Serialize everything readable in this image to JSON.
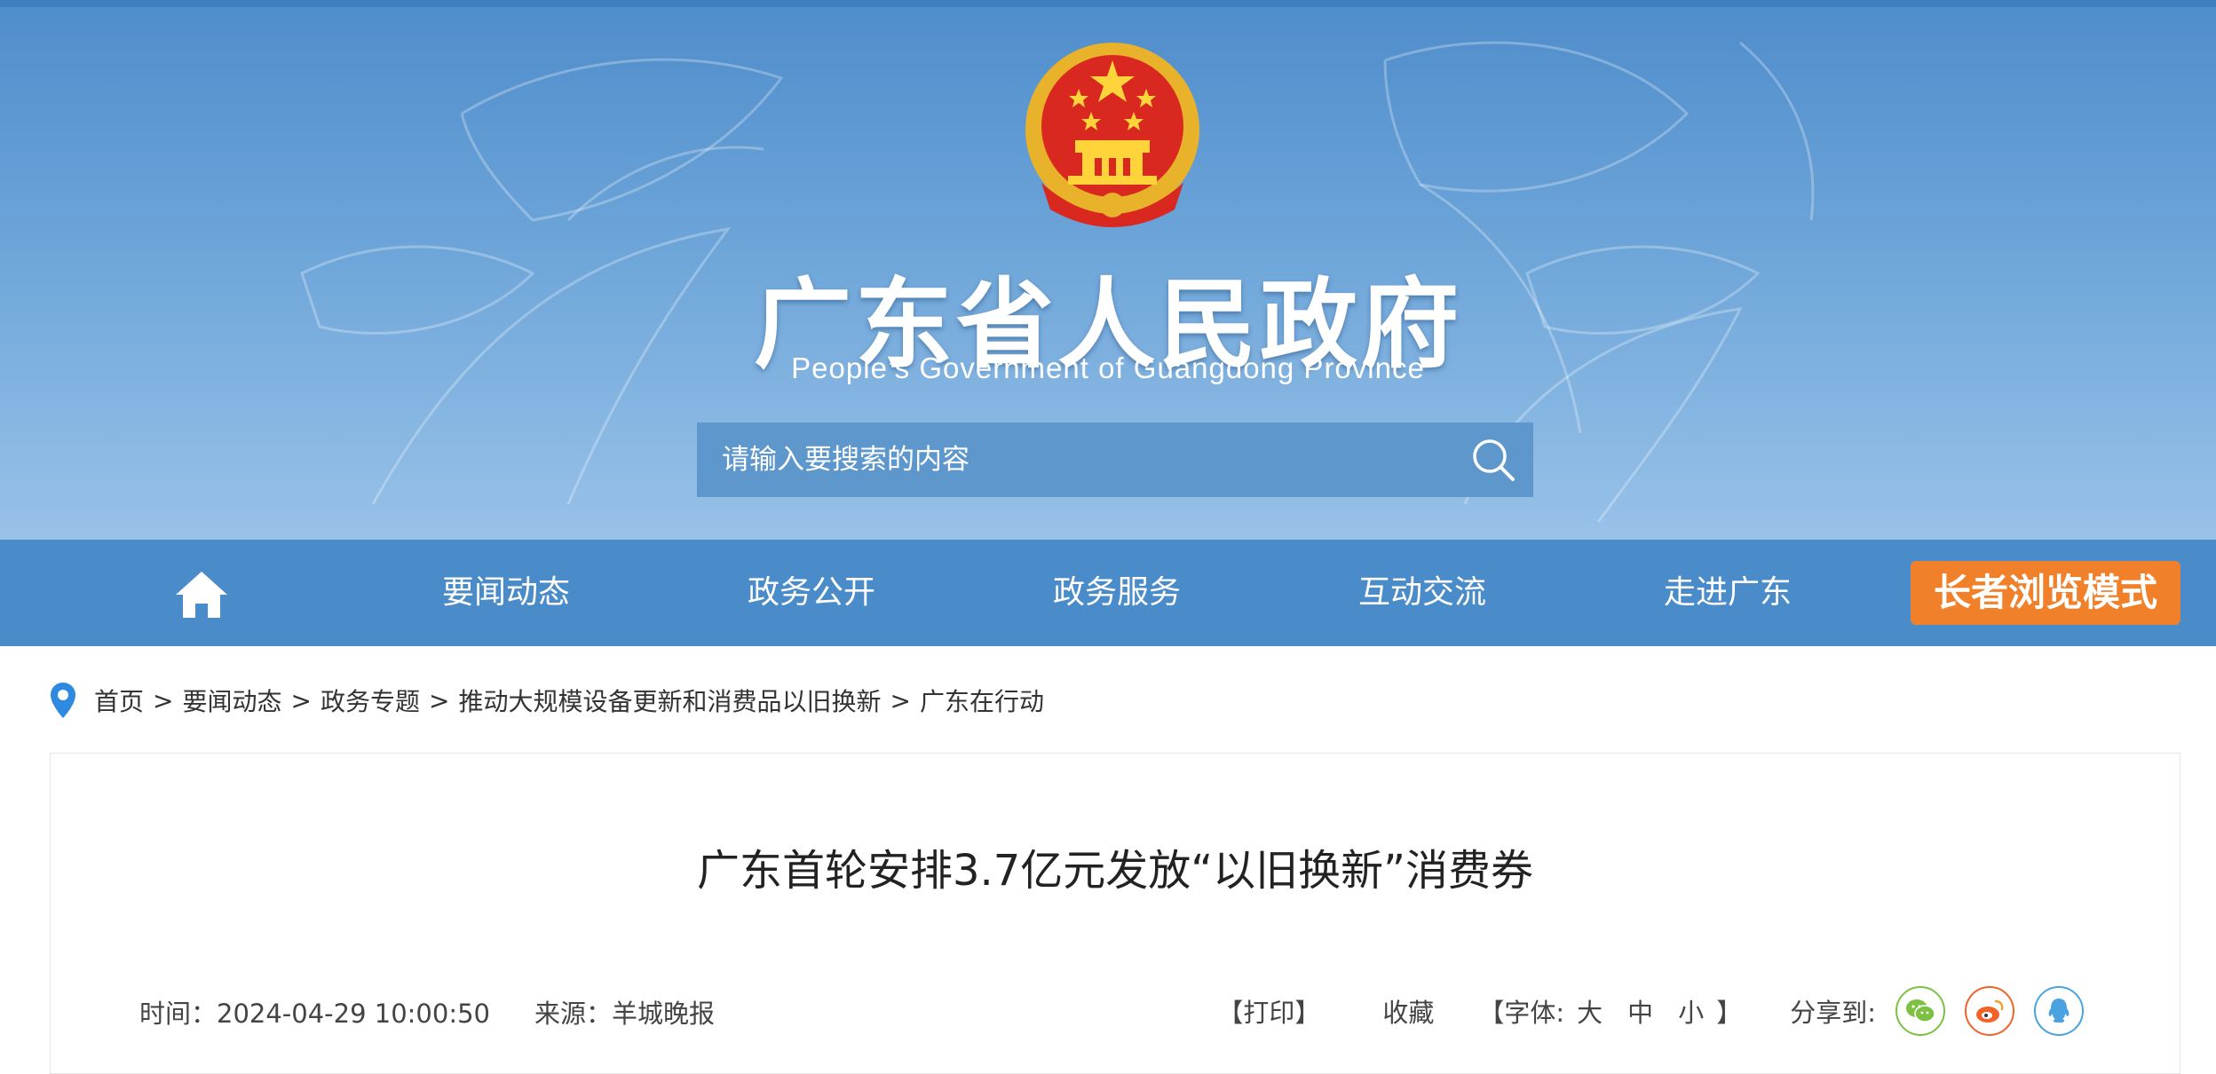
{
  "header": {
    "title": "广东省人民政府",
    "subtitle": "People’s Government of Guangdong Province",
    "search_placeholder": "请输入要搜索的内容"
  },
  "nav": {
    "items": [
      "要闻动态",
      "政务公开",
      "政务服务",
      "互动交流",
      "走进广东"
    ],
    "elder_mode": "长者浏览模式"
  },
  "breadcrumb": {
    "items": [
      "首页",
      "要闻动态",
      "政务专题",
      "推动大规模设备更新和消费品以旧换新",
      "广东在行动"
    ],
    "separator": ">"
  },
  "article": {
    "title": "广东首轮安排3.7亿元发放“以旧换新”消费券",
    "time": "时间：2024-04-29 10:00:50",
    "source": "来源：羊城晚报"
  },
  "tools": {
    "print": "【打印】",
    "favorite": "收藏",
    "font_prefix": "【字体:",
    "font_large": "大",
    "font_medium": "中",
    "font_small": "小",
    "font_suffix": "】",
    "share_label": "分享到:"
  },
  "colors": {
    "nav_bg": "#4a8bc9",
    "elder_btn": "#f0812a",
    "wechat": "#7cc142",
    "weibo": "#f0642a",
    "qq": "#4aa3e0"
  }
}
